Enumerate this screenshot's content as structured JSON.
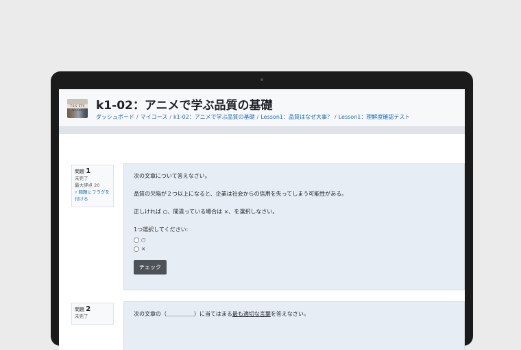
{
  "page": {
    "title": "k1-02：アニメで学ぶ品質の基礎",
    "thumb_text": "T.S.S. ET'S SCHOOL"
  },
  "breadcrumb": [
    "ダッシュボード",
    "マイコース",
    "k1-02：アニメで学ぶ品質の基礎",
    "Lesson1：品質はなぜ大事？",
    "Lesson1：理解度確認テスト"
  ],
  "questions": [
    {
      "label": "問題",
      "number": "1",
      "status": "未完了",
      "max_score": "最大評点 20",
      "flag": "問題にフラグを付ける",
      "lines": [
        "次の文章について答えなさい。",
        "品質の欠陥が２つ以上になると、企業は社会からの信用を失ってしまう可能性がある。",
        "正しければ ○、間違っている場合は ×、を選択しなさい。"
      ],
      "prompt": "1つ選択してください:",
      "options": [
        "○",
        "×"
      ],
      "check_label": "チェック"
    },
    {
      "label": "問題",
      "number": "2",
      "status": "未完了",
      "text_pre": "次の文章の（＿＿＿＿＿）に当てはまる",
      "text_u1": "最も適切な",
      "text_u2": "言葉",
      "text_post": "を答えなさい。"
    }
  ]
}
